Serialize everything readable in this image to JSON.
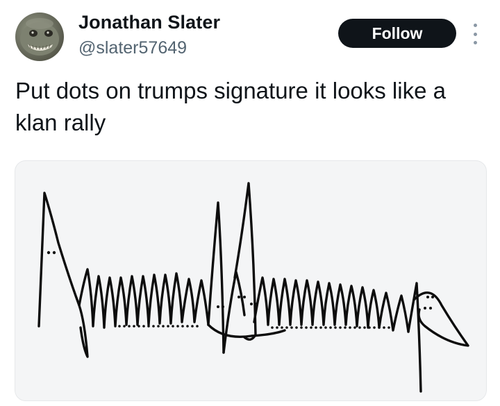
{
  "author": {
    "display_name": "Jonathan Slater",
    "handle": "@slater57649",
    "avatar_icon": "creature-avatar-icon"
  },
  "actions": {
    "follow_label": "Follow",
    "more_icon": "more-vertical-icon"
  },
  "tweet": {
    "text": "Put dots on trumps signature it looks like a klan rally"
  },
  "media": {
    "description_icon": "signature-image",
    "background_color": "#f4f5f6",
    "ink_color": "#0d0d0d"
  },
  "colors": {
    "follow_bg": "#0f1419",
    "follow_text": "#ffffff",
    "handle_text": "#536471"
  }
}
